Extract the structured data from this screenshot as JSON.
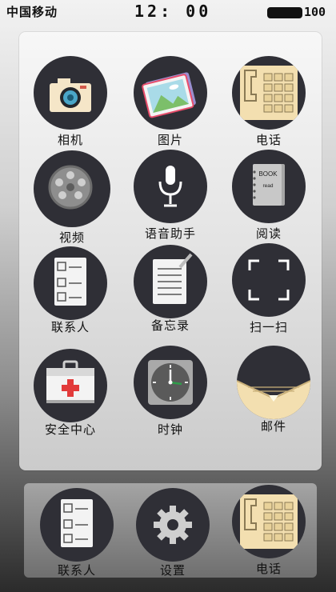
{
  "status_bar": {
    "carrier": "中国移动",
    "time": "12: 00",
    "battery": "100"
  },
  "home_apps": [
    {
      "label": "相机",
      "icon": "camera-icon"
    },
    {
      "label": "图片",
      "icon": "photo-icon"
    },
    {
      "label": "电话",
      "icon": "phone-keypad-icon"
    },
    {
      "label": "视频",
      "icon": "film-reel-icon"
    },
    {
      "label": "语音助手",
      "icon": "microphone-icon"
    },
    {
      "label": "阅读",
      "icon": "book-icon"
    },
    {
      "label": "联系人",
      "icon": "contacts-icon"
    },
    {
      "label": "备忘录",
      "icon": "memo-icon"
    },
    {
      "label": "扫一扫",
      "icon": "scan-icon"
    },
    {
      "label": "安全中心",
      "icon": "first-aid-icon"
    },
    {
      "label": "时钟",
      "icon": "clock-icon"
    },
    {
      "label": "邮件",
      "icon": "mail-icon"
    }
  ],
  "book_icon_text": {
    "line1": "BOOK",
    "line2": "read"
  },
  "dock_apps": [
    {
      "label": "联系人",
      "icon": "contacts-icon"
    },
    {
      "label": "设置",
      "icon": "gear-icon"
    },
    {
      "label": "电话",
      "icon": "phone-keypad-icon"
    }
  ],
  "colors": {
    "icon_circle": "#2f2f36",
    "accent_cream": "#f3dfb0",
    "accent_red": "#e23b3b"
  }
}
